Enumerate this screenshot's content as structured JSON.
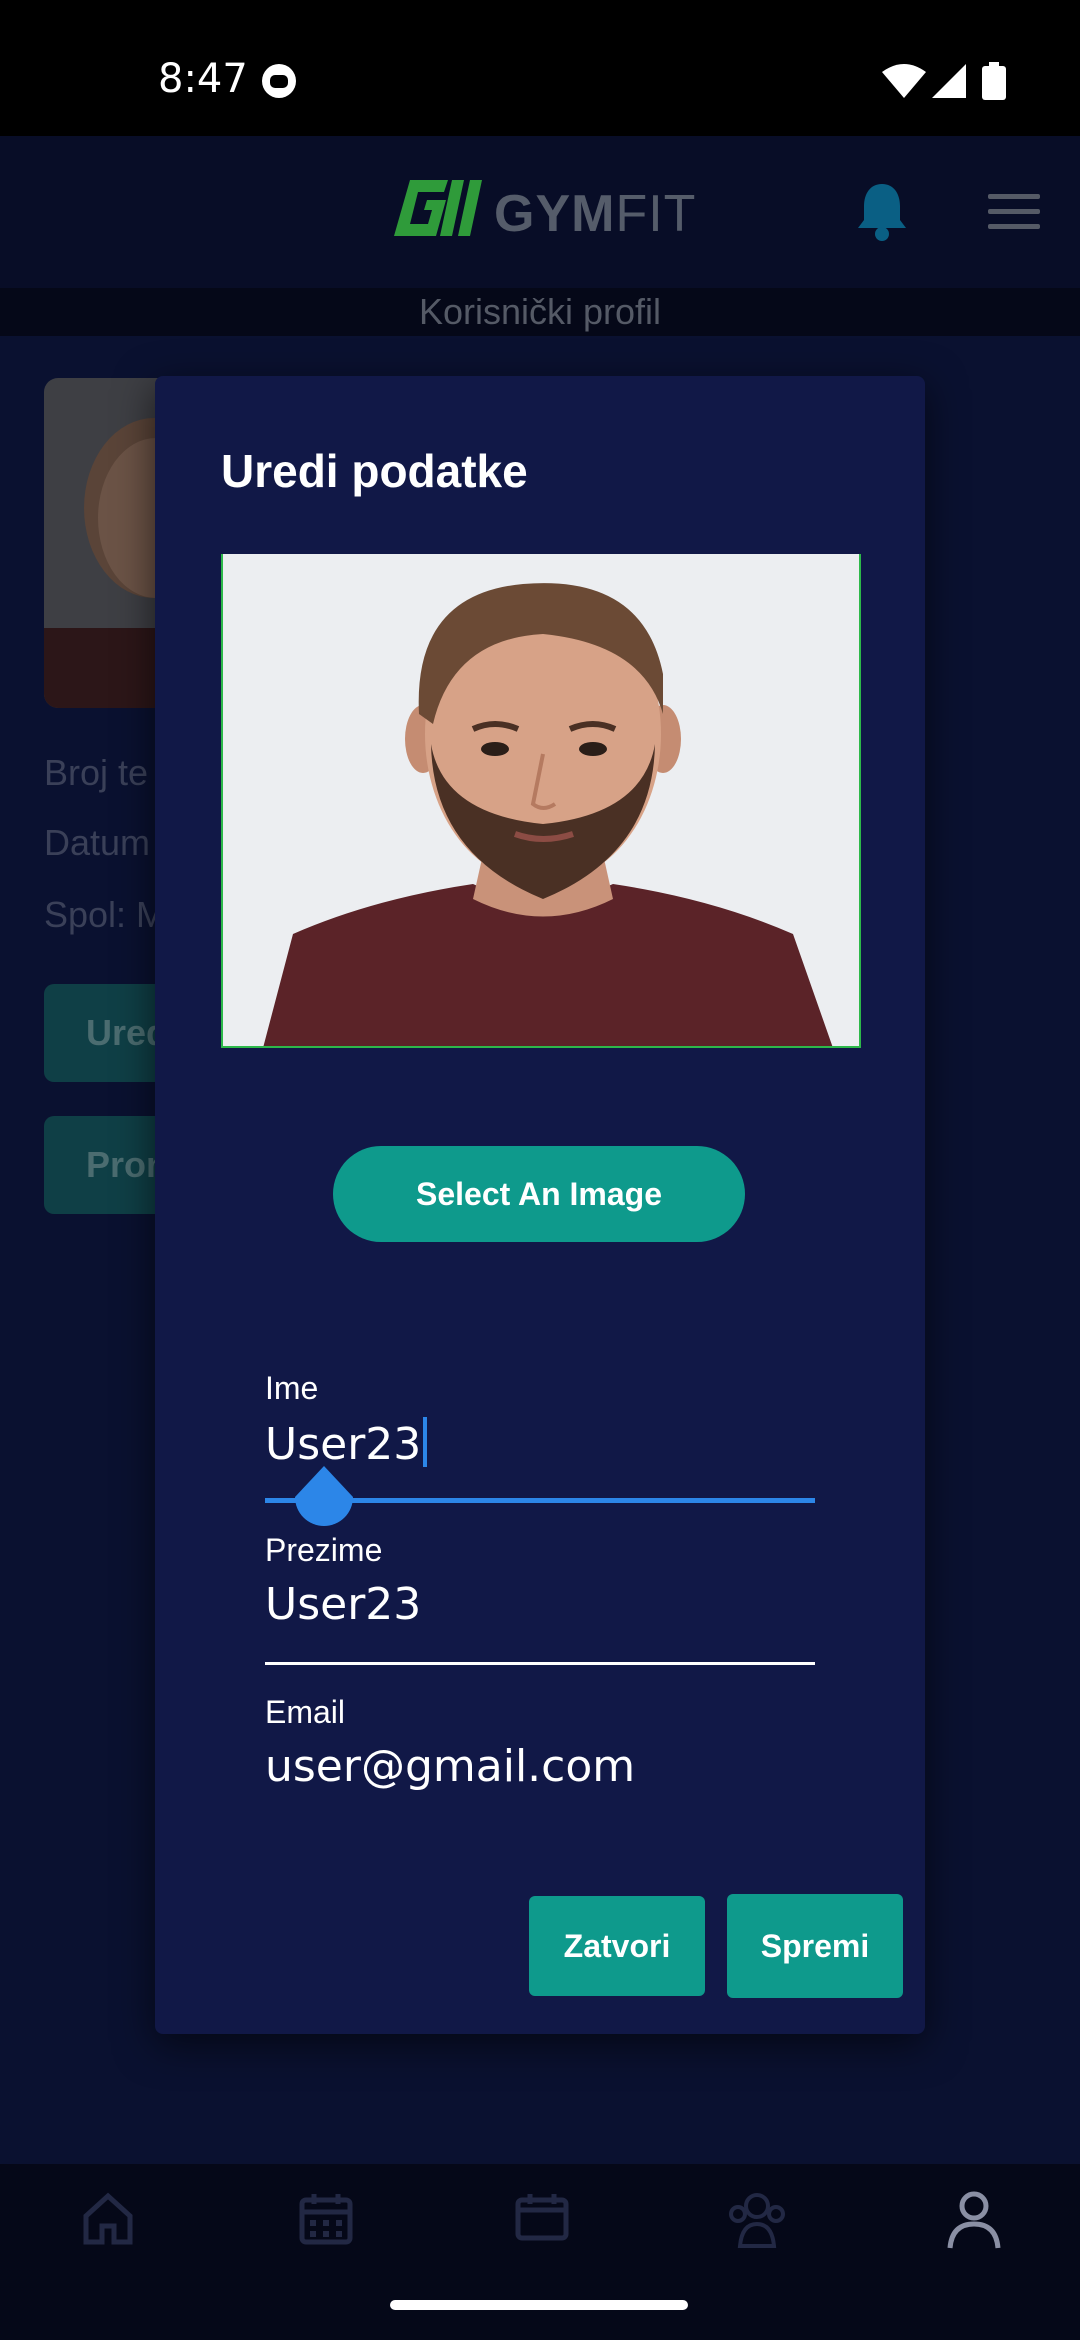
{
  "status_bar": {
    "time": "8:47"
  },
  "app_bar": {
    "brand_bold": "GYM",
    "brand_light": "FIT"
  },
  "page": {
    "subtitle": "Korisnički profil"
  },
  "background_profile": {
    "line1": "Broj te",
    "line2": "Datum",
    "line3": "Spol: M",
    "button1": "Ured",
    "button2": "Pron"
  },
  "dialog": {
    "title": "Uredi podatke",
    "select_image_label": "Select An Image",
    "fields": [
      {
        "label": "Ime",
        "value": "User23"
      },
      {
        "label": "Prezime",
        "value": "User23"
      },
      {
        "label": "Email",
        "value": "user@gmail.com"
      }
    ],
    "close_label": "Zatvori",
    "save_label": "Spremi"
  },
  "colors": {
    "accent": "#0e9a8c",
    "dialog_bg": "#111847",
    "focus": "#2c86e8"
  },
  "bottom_nav": [
    "home-icon",
    "calendar-icon",
    "calendar-check-icon",
    "group-icon",
    "profile-icon"
  ]
}
